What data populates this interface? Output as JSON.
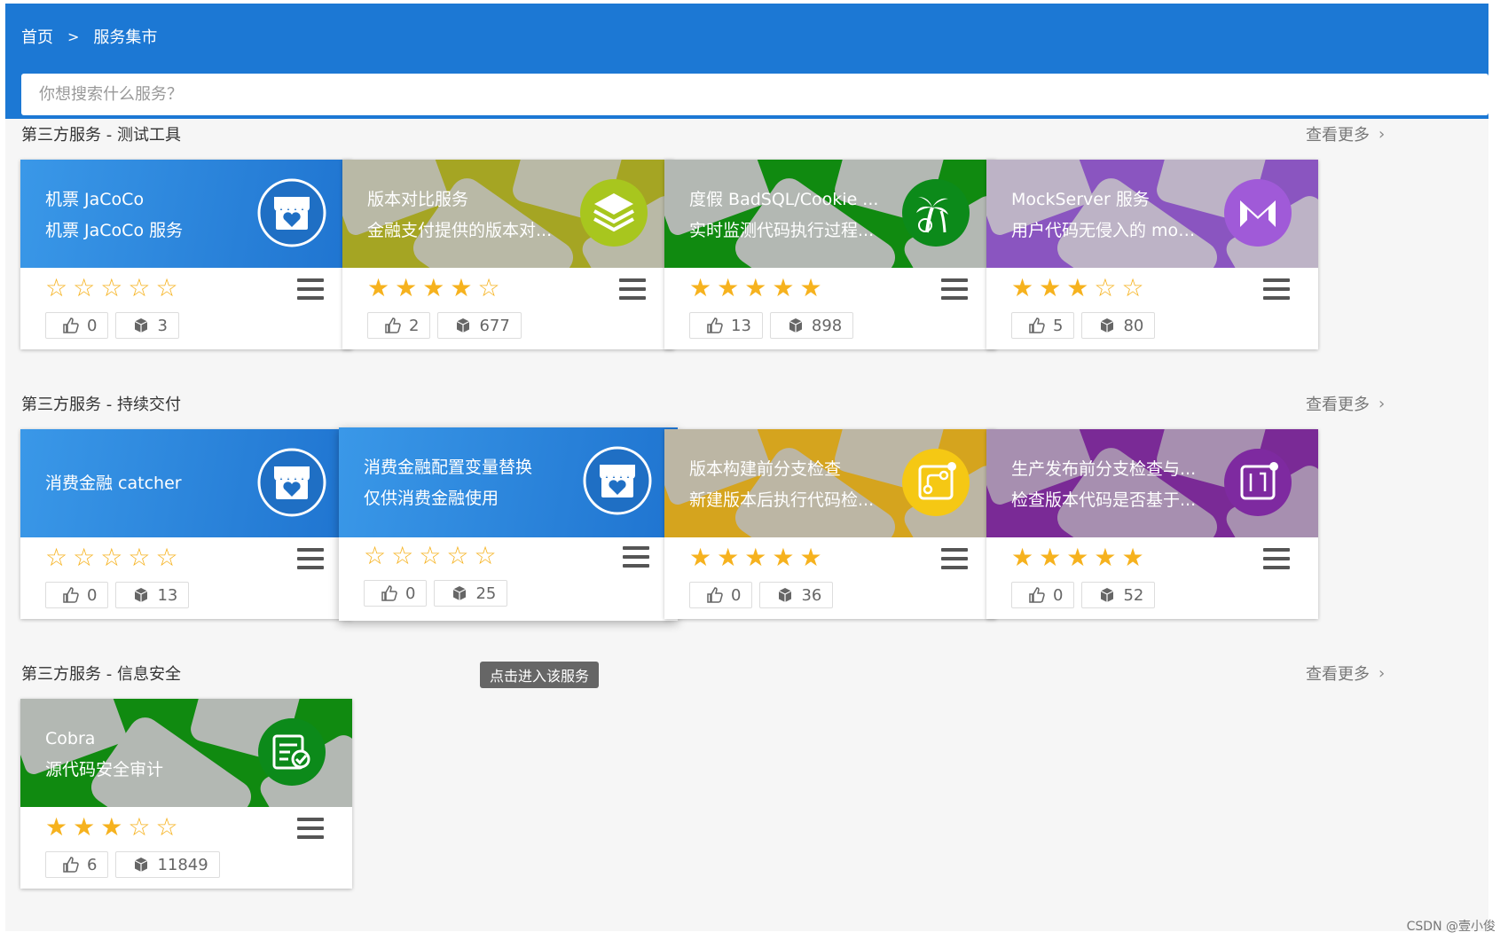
{
  "breadcrumb": {
    "home": "首页",
    "separator": ">",
    "current": "服务集市"
  },
  "search": {
    "placeholder": "你想搜索什么服务？"
  },
  "more_label": "查看更多",
  "sections": [
    {
      "title": "第三方服务 - 测试工具",
      "cards": [
        {
          "line1": "机票 JaCoCo",
          "line2": "机票 JaCoCo 服务",
          "rating": 0,
          "likes": "0",
          "uses": "3",
          "theme": "blue",
          "icon": "store-heart-icon"
        },
        {
          "line1": "版本对比服务",
          "line2": "金融支付提供的版本对...",
          "rating": 4,
          "likes": "2",
          "uses": "677",
          "theme": "olive",
          "icon": "layers-icon"
        },
        {
          "line1": "度假 BadSQL/Cookie ...",
          "line2": "实时监测代码执行过程...",
          "rating": 5,
          "likes": "13",
          "uses": "898",
          "theme": "green",
          "icon": "palm-tree-icon"
        },
        {
          "line1": "MockServer 服务",
          "line2": "用户代码无侵入的 moc...",
          "rating": 3,
          "likes": "5",
          "uses": "80",
          "theme": "purple",
          "icon": "mock-logo-icon"
        }
      ]
    },
    {
      "title": "第三方服务 - 持续交付",
      "cards": [
        {
          "line1": "消费金融 catcher",
          "line2": "",
          "rating": 0,
          "likes": "0",
          "uses": "13",
          "theme": "blue",
          "icon": "store-heart-icon"
        },
        {
          "line1": "消费金融配置变量替换",
          "line2": "仅供消费金融使用",
          "rating": 0,
          "likes": "0",
          "uses": "25",
          "theme": "blue",
          "icon": "store-heart-icon"
        },
        {
          "line1": "版本构建前分支检查",
          "line2": "新建版本后执行代码检...",
          "rating": 5,
          "likes": "0",
          "uses": "36",
          "theme": "gold",
          "icon": "branch-icon"
        },
        {
          "line1": "生产发布前分支检查与...",
          "line2": "检查版本代码是否基于...",
          "rating": 5,
          "likes": "0",
          "uses": "52",
          "theme": "violet",
          "icon": "pull-request-icon"
        }
      ]
    },
    {
      "title": "第三方服务 - 信息安全",
      "cards": [
        {
          "line1": "Cobra",
          "line2": "源代码安全审计",
          "rating": 3,
          "likes": "6",
          "uses": "11849",
          "theme": "green",
          "icon": "code-audit-icon"
        }
      ]
    }
  ],
  "tooltip": "点击进入该服务",
  "watermark": "CSDN @壹小俊",
  "colors": {
    "header": "#1c78d4",
    "star": "#f6b21e",
    "blue": "#2c86dc",
    "olive": "#a5a523",
    "green": "#108a10",
    "purple": "#8a55c0",
    "gold": "#d5a41e",
    "violet": "#7a2a96"
  }
}
